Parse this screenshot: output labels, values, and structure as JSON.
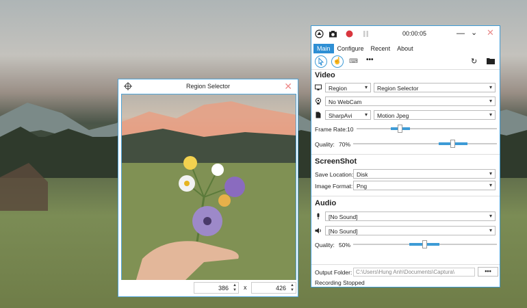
{
  "region_selector": {
    "title": "Region Selector",
    "width_value": "386",
    "height_value": "426",
    "separator": "x"
  },
  "main_window": {
    "timer": "00:00:05",
    "menu": [
      "Main",
      "Configure",
      "Recent",
      "About"
    ],
    "video": {
      "heading": "Video",
      "source": "Region",
      "source_target": "Region Selector",
      "webcam": "No WebCam",
      "encoder": "SharpAvi",
      "codec": "Motion Jpeg",
      "frame_rate_label": "Frame Rate:",
      "frame_rate_value": "10",
      "quality_label": "Quality:",
      "quality_value": "70%"
    },
    "screenshot": {
      "heading": "ScreenShot",
      "save_location_label": "Save Location:",
      "save_location_value": "Disk",
      "image_format_label": "Image Format:",
      "image_format_value": "Png"
    },
    "audio": {
      "heading": "Audio",
      "mic": "[No Sound]",
      "speaker": "[No Sound]",
      "quality_label": "Quality:",
      "quality_value": "50%"
    },
    "output_folder_label": "Output Folder:",
    "output_folder_value": "C:\\Users\\Hung Anh\\Documents\\Captura\\",
    "browse_label": "•••",
    "status": "Recording Stopped"
  },
  "colors": {
    "accent": "#2e8fd4",
    "record": "#d9363e",
    "close": "#e88a8a"
  }
}
